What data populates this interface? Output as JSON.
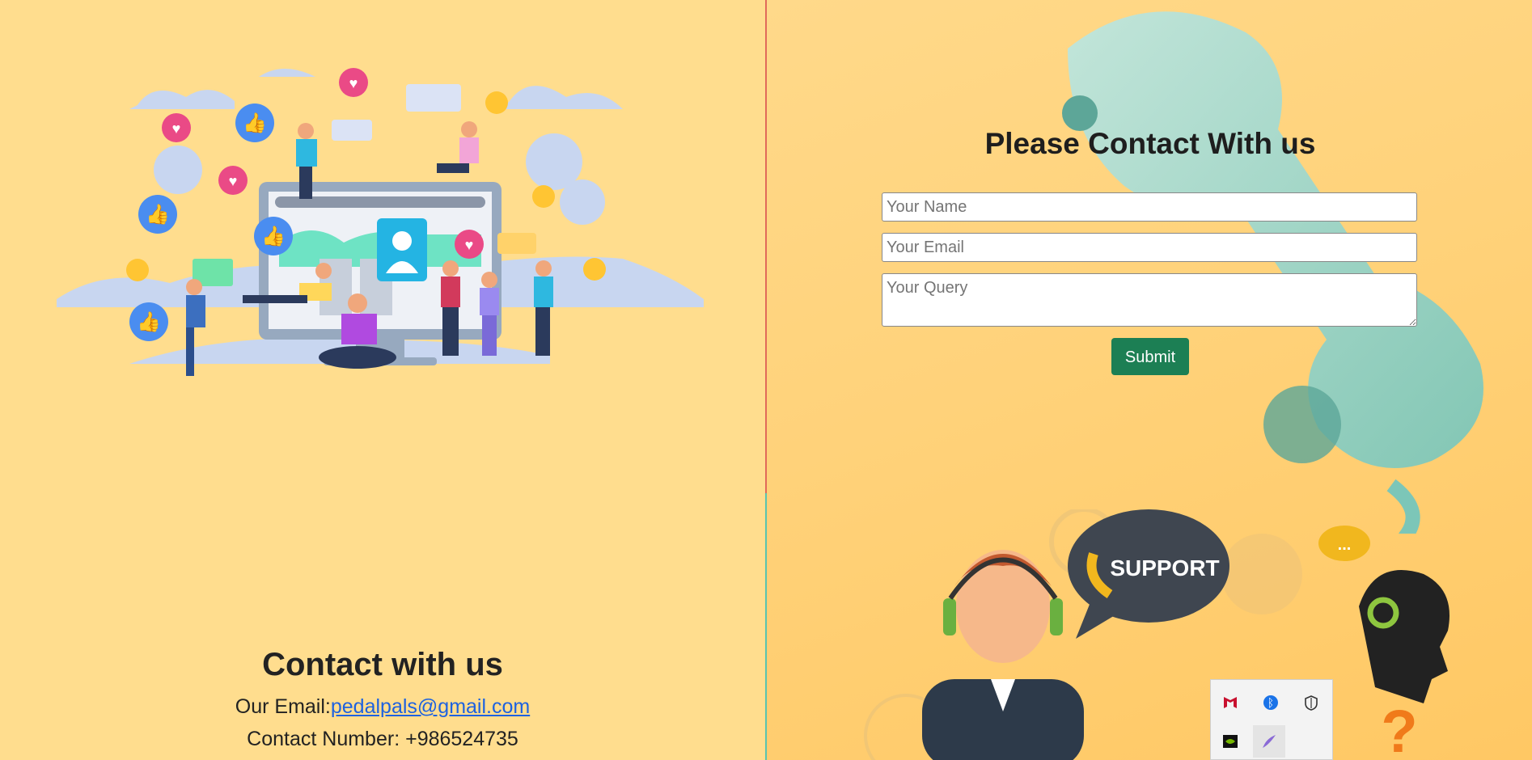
{
  "left": {
    "contact_title": "Contact with us",
    "email_label": "Our Email:",
    "email": "pedalpals@gmail.com",
    "phone_label": "Contact Number: ",
    "phone": "+986524735"
  },
  "form": {
    "title": "Please Contact With us",
    "name_placeholder": "Your Name",
    "email_placeholder": "Your Email",
    "query_placeholder": "Your Query",
    "submit_label": "Submit"
  },
  "illustration": {
    "support_text": "SUPPORT",
    "question_mark": "?",
    "chat_dots": "..."
  },
  "tray": {
    "icons": [
      "mcafee-icon",
      "bluetooth-icon",
      "security-shield-icon",
      "nvidia-icon",
      "feather-pen-icon"
    ],
    "bluetooth_glyph": "ᛒ"
  },
  "colors": {
    "background": "#ffdd8e",
    "submit": "#1c7f54",
    "link": "#1d62e0"
  }
}
